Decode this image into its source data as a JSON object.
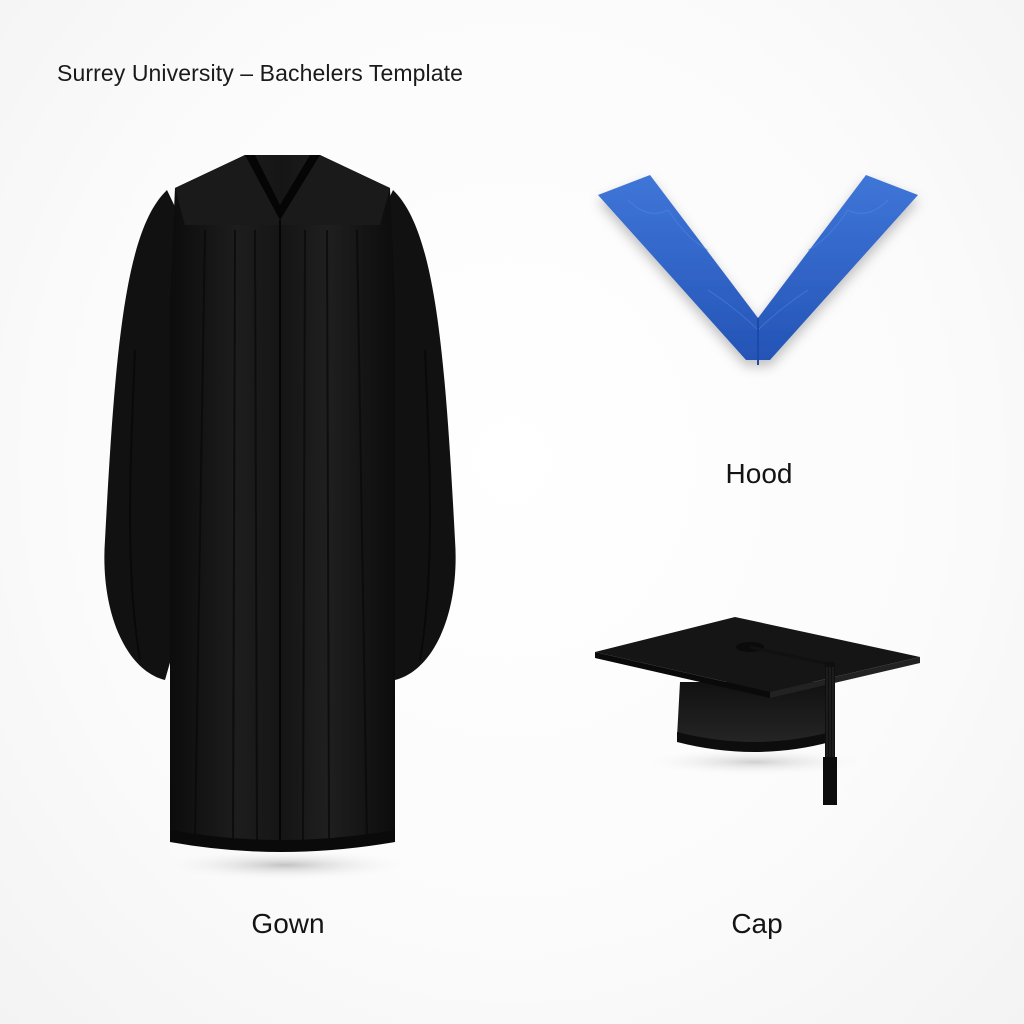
{
  "title": "Surrey University – Bachelers Template",
  "items": {
    "gown": {
      "label": "Gown",
      "icon": "gown-icon",
      "color": "#161616"
    },
    "hood": {
      "label": "Hood",
      "icon": "hood-icon",
      "color": "#2f63c9"
    },
    "cap": {
      "label": "Cap",
      "icon": "mortarboard-cap-icon",
      "color": "#1a1a1a"
    }
  }
}
